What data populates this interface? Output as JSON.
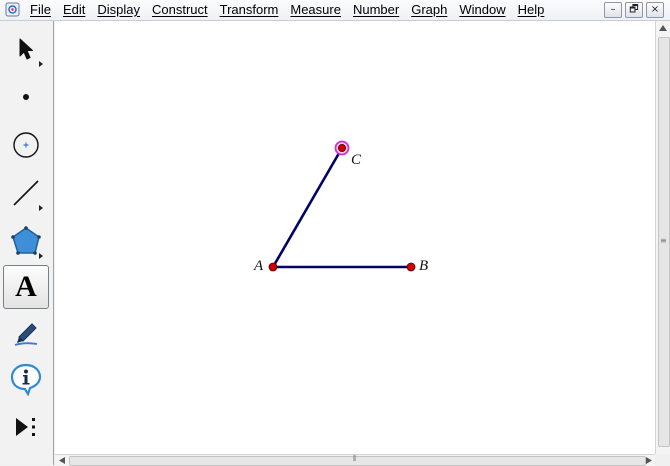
{
  "menu": {
    "items": [
      "File",
      "Edit",
      "Display",
      "Construct",
      "Transform",
      "Measure",
      "Number",
      "Graph",
      "Window",
      "Help"
    ]
  },
  "window_controls": {
    "minimize": "–",
    "restore": "🗗",
    "close": "×"
  },
  "toolbox": {
    "tools": [
      {
        "name": "selection-arrow-tool",
        "icon": "arrow-pointer-icon"
      },
      {
        "name": "point-tool",
        "icon": "point-dot-icon"
      },
      {
        "name": "compass-tool",
        "icon": "circle-icon"
      },
      {
        "name": "straightedge-tool",
        "icon": "segment-icon"
      },
      {
        "name": "polygon-tool",
        "icon": "pentagon-icon"
      },
      {
        "name": "text-tool",
        "icon": "letter-a-icon",
        "glyph": "A",
        "selected": true
      },
      {
        "name": "marker-tool",
        "icon": "pen-icon"
      },
      {
        "name": "information-tool",
        "icon": "info-icon"
      },
      {
        "name": "custom-tool",
        "icon": "play-dots-icon"
      }
    ]
  },
  "construction": {
    "points": [
      {
        "id": "A",
        "label": "A",
        "color": "#cc0000"
      },
      {
        "id": "B",
        "label": "B",
        "color": "#cc0000"
      },
      {
        "id": "C",
        "label": "C",
        "color": "#cc0000",
        "highlight": "#cc33cc"
      }
    ],
    "segments": [
      {
        "from": "A",
        "to": "B",
        "color": "#000066"
      },
      {
        "from": "A",
        "to": "C",
        "color": "#000066"
      }
    ]
  }
}
